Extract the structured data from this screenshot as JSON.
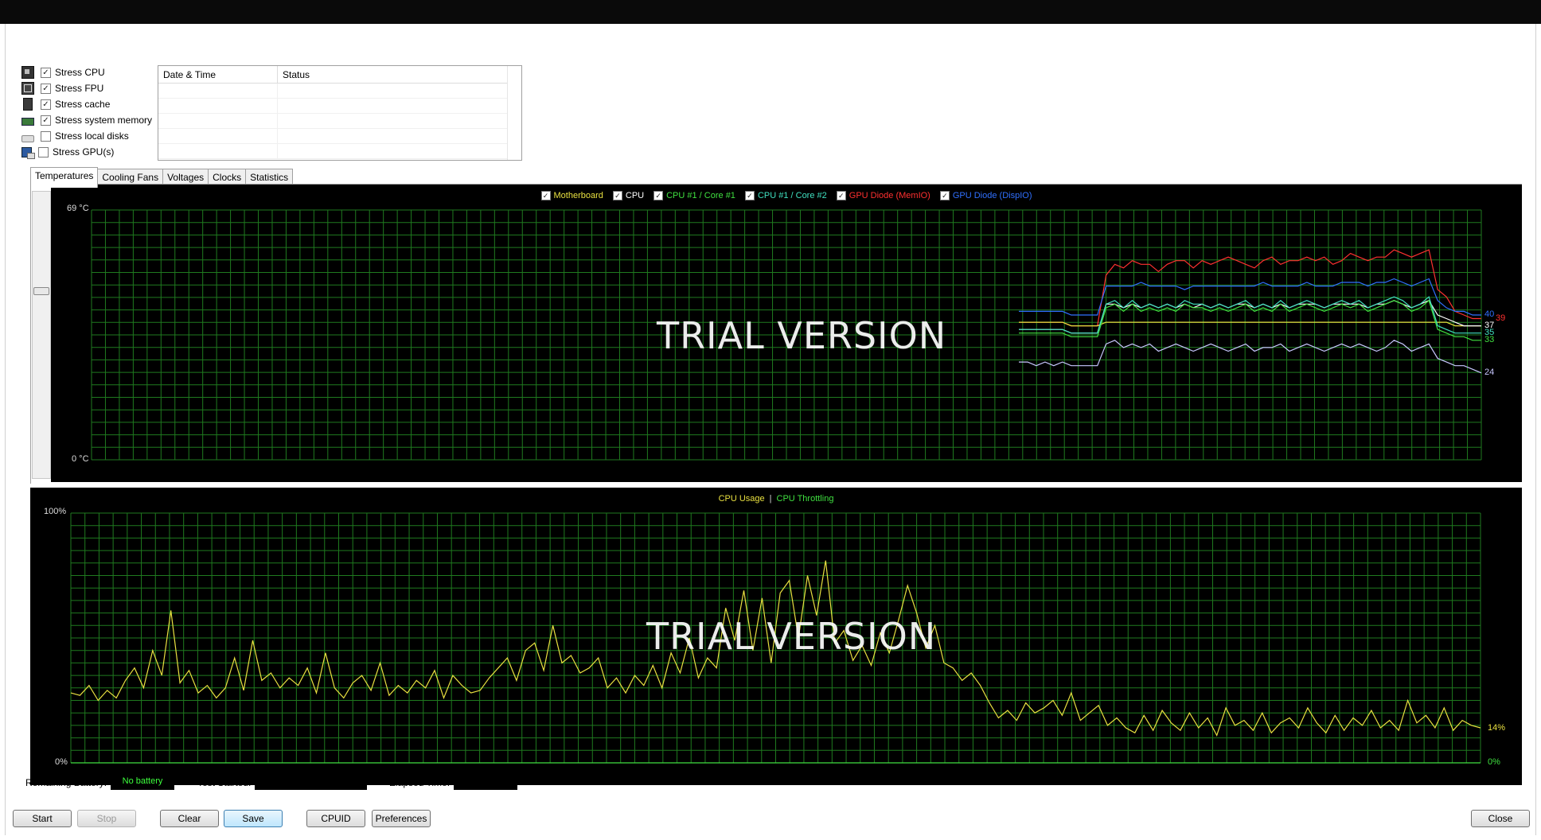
{
  "stress_options": [
    {
      "label": "Stress CPU",
      "checked": true,
      "icon": "cpu-chip-icon"
    },
    {
      "label": "Stress FPU",
      "checked": true,
      "icon": "fpu-icon"
    },
    {
      "label": "Stress cache",
      "checked": true,
      "icon": "cache-icon"
    },
    {
      "label": "Stress system memory",
      "checked": true,
      "icon": "memory-icon"
    },
    {
      "label": "Stress local disks",
      "checked": false,
      "icon": "disk-icon"
    },
    {
      "label": "Stress GPU(s)",
      "checked": false,
      "icon": "gpu-icon"
    }
  ],
  "log_table": {
    "columns": [
      "Date & Time",
      "Status"
    ],
    "rows": []
  },
  "tabs": [
    "Temperatures",
    "Cooling Fans",
    "Voltages",
    "Clocks",
    "Statistics"
  ],
  "active_tab": "Temperatures",
  "temperature_chart": {
    "legend": [
      {
        "label": "Motherboard",
        "color": "#e8e040"
      },
      {
        "label": "CPU",
        "color": "#ffffff"
      },
      {
        "label": "CPU #1 / Core #1",
        "color": "#40e040"
      },
      {
        "label": "CPU #1 / Core #2",
        "color": "#40e0c0"
      },
      {
        "label": "GPU Diode (MemIO)",
        "color": "#ff3030"
      },
      {
        "label": "GPU Diode (DispIO)",
        "color": "#3070ff"
      }
    ],
    "y_max_label": "69 °C",
    "y_min_label": "0 °C",
    "end_values": [
      {
        "value": "40",
        "color": "#3070ff"
      },
      {
        "value": "39",
        "color": "#ff3030"
      },
      {
        "value": "37",
        "color": "#ffffff"
      },
      {
        "value": "35",
        "color": "#40e0c0"
      },
      {
        "value": "33",
        "color": "#40e040"
      },
      {
        "value": "24",
        "color": "#c8c8ff"
      }
    ],
    "watermark": "TRIAL VERSION"
  },
  "usage_chart": {
    "legend_usage": "CPU Usage",
    "legend_sep": "|",
    "legend_throttle": "CPU Throttling",
    "y_max_label": "100%",
    "y_min_label": "0%",
    "end_usage": "14%",
    "end_throttle": "0%",
    "watermark": "TRIAL VERSION"
  },
  "status": {
    "battery_label": "Remaining Battery:",
    "battery_value": "No battery",
    "test_started_label": "Test Started:",
    "elapsed_label": "Elapsed Time:"
  },
  "buttons": {
    "start": "Start",
    "stop": "Stop",
    "clear": "Clear",
    "save": "Save",
    "cpuid": "CPUID",
    "preferences": "Preferences",
    "close": "Close"
  },
  "chart_data": [
    {
      "type": "line",
      "title": "",
      "ylim": [
        0,
        69
      ],
      "y_unit": "°C",
      "x_points": 54,
      "series": [
        {
          "name": "GPU Diode (MemIO)",
          "color": "#ff3030",
          "values": [
            38,
            38,
            38,
            38,
            38,
            38,
            37,
            37,
            37,
            37,
            51,
            54,
            53,
            55,
            54,
            54,
            52,
            54,
            55,
            55,
            53,
            55,
            54,
            55,
            56,
            55,
            54,
            53,
            55,
            56,
            54,
            55,
            55,
            56,
            55,
            56,
            54,
            55,
            57,
            56,
            55,
            56,
            56,
            58,
            57,
            56,
            57,
            58,
            47,
            45,
            41,
            40,
            39,
            39
          ]
        },
        {
          "name": "GPU Diode (DispIO)",
          "color": "#3070ff",
          "values": [
            41,
            41,
            41,
            41,
            41,
            41,
            40,
            40,
            40,
            40,
            48,
            48,
            48,
            48,
            49,
            48,
            48,
            48,
            48,
            47,
            48,
            48,
            48,
            48,
            48,
            48,
            48,
            48,
            49,
            48,
            48,
            48,
            48,
            49,
            48,
            48,
            48,
            49,
            49,
            49,
            48,
            49,
            49,
            50,
            49,
            48,
            49,
            50,
            44,
            42,
            41,
            41,
            40,
            40
          ]
        },
        {
          "name": "Motherboard",
          "color": "#e8e040",
          "values": [
            38,
            38,
            38,
            38,
            38,
            38,
            37,
            37,
            37,
            37,
            38,
            38,
            38,
            38,
            38,
            38,
            38,
            38,
            38,
            38,
            38,
            38,
            38,
            38,
            38,
            38,
            38,
            38,
            38,
            38,
            38,
            38,
            38,
            38,
            38,
            38,
            38,
            38,
            38,
            38,
            38,
            38,
            38,
            38,
            38,
            38,
            38,
            38,
            38,
            38,
            37,
            37,
            37,
            37
          ]
        },
        {
          "name": "CPU",
          "color": "#ffffff",
          "values": [
            36,
            36,
            36,
            36,
            36,
            36,
            35,
            35,
            35,
            35,
            43,
            43,
            42,
            43,
            42,
            43,
            42,
            43,
            42,
            43,
            42,
            43,
            42,
            43,
            42,
            43,
            43,
            42,
            43,
            42,
            43,
            42,
            43,
            43,
            43,
            42,
            43,
            43,
            43,
            43,
            42,
            43,
            43,
            44,
            43,
            42,
            43,
            44,
            40,
            39,
            38,
            37,
            37,
            37
          ]
        },
        {
          "name": "CPU #1 / Core #1",
          "color": "#40e040",
          "values": [
            35,
            35,
            35,
            35,
            35,
            35,
            34,
            34,
            34,
            34,
            42,
            43,
            41,
            43,
            41,
            42,
            41,
            42,
            41,
            43,
            42,
            42,
            41,
            42,
            41,
            42,
            43,
            41,
            42,
            41,
            43,
            41,
            42,
            43,
            42,
            41,
            42,
            43,
            42,
            43,
            41,
            42,
            43,
            44,
            43,
            41,
            42,
            44,
            36,
            35,
            34,
            34,
            33,
            33
          ]
        },
        {
          "name": "CPU #1 / Core #2",
          "color": "#40e0c0",
          "values": [
            36,
            36,
            36,
            36,
            36,
            36,
            35,
            35,
            35,
            35,
            43,
            44,
            42,
            44,
            42,
            43,
            42,
            43,
            42,
            44,
            43,
            43,
            42,
            43,
            42,
            43,
            44,
            42,
            43,
            42,
            44,
            42,
            43,
            44,
            43,
            42,
            43,
            44,
            43,
            44,
            42,
            43,
            44,
            45,
            44,
            42,
            43,
            45,
            37,
            36,
            35,
            35,
            35,
            35
          ]
        },
        {
          "name": "",
          "color": "#c8c8ff",
          "values": [
            27,
            27,
            26,
            27,
            26,
            27,
            26,
            26,
            26,
            26,
            32,
            33,
            31,
            32,
            31,
            32,
            30,
            31,
            32,
            31,
            30,
            31,
            32,
            31,
            30,
            31,
            32,
            30,
            31,
            31,
            32,
            30,
            31,
            32,
            31,
            30,
            31,
            32,
            31,
            32,
            31,
            30,
            31,
            33,
            32,
            30,
            31,
            32,
            28,
            27,
            26,
            26,
            25,
            24
          ]
        }
      ]
    },
    {
      "type": "line",
      "title": "",
      "ylim": [
        0,
        100
      ],
      "y_unit": "%",
      "series": [
        {
          "name": "CPU Usage",
          "color": "#e8e040",
          "values": [
            28,
            27,
            31,
            25,
            29,
            26,
            33,
            38,
            30,
            45,
            35,
            61,
            32,
            37,
            28,
            31,
            26,
            30,
            42,
            29,
            49,
            33,
            36,
            30,
            34,
            31,
            38,
            28,
            44,
            30,
            26,
            32,
            35,
            29,
            40,
            27,
            31,
            28,
            33,
            30,
            37,
            26,
            35,
            31,
            28,
            29,
            34,
            38,
            42,
            33,
            45,
            48,
            37,
            55,
            40,
            43,
            36,
            38,
            42,
            30,
            34,
            28,
            35,
            31,
            39,
            30,
            44,
            36,
            50,
            34,
            42,
            38,
            62,
            49,
            69,
            45,
            66,
            40,
            68,
            73,
            50,
            75,
            59,
            81,
            48,
            53,
            41,
            47,
            39,
            52,
            44,
            57,
            71,
            60,
            46,
            55,
            40,
            38,
            33,
            36,
            31,
            24,
            18,
            21,
            17,
            24,
            20,
            22,
            25,
            19,
            28,
            17,
            20,
            23,
            15,
            18,
            14,
            12,
            19,
            13,
            21,
            16,
            13,
            20,
            14,
            18,
            11,
            22,
            15,
            17,
            13,
            20,
            12,
            16,
            18,
            14,
            22,
            16,
            12,
            19,
            13,
            18,
            15,
            21,
            14,
            17,
            13,
            25,
            16,
            19,
            14,
            22,
            13,
            17,
            15,
            14
          ]
        },
        {
          "name": "CPU Throttling",
          "color": "#40e040",
          "values": [
            0,
            0,
            0,
            0,
            0,
            0,
            0,
            0,
            0,
            0
          ]
        }
      ]
    }
  ]
}
